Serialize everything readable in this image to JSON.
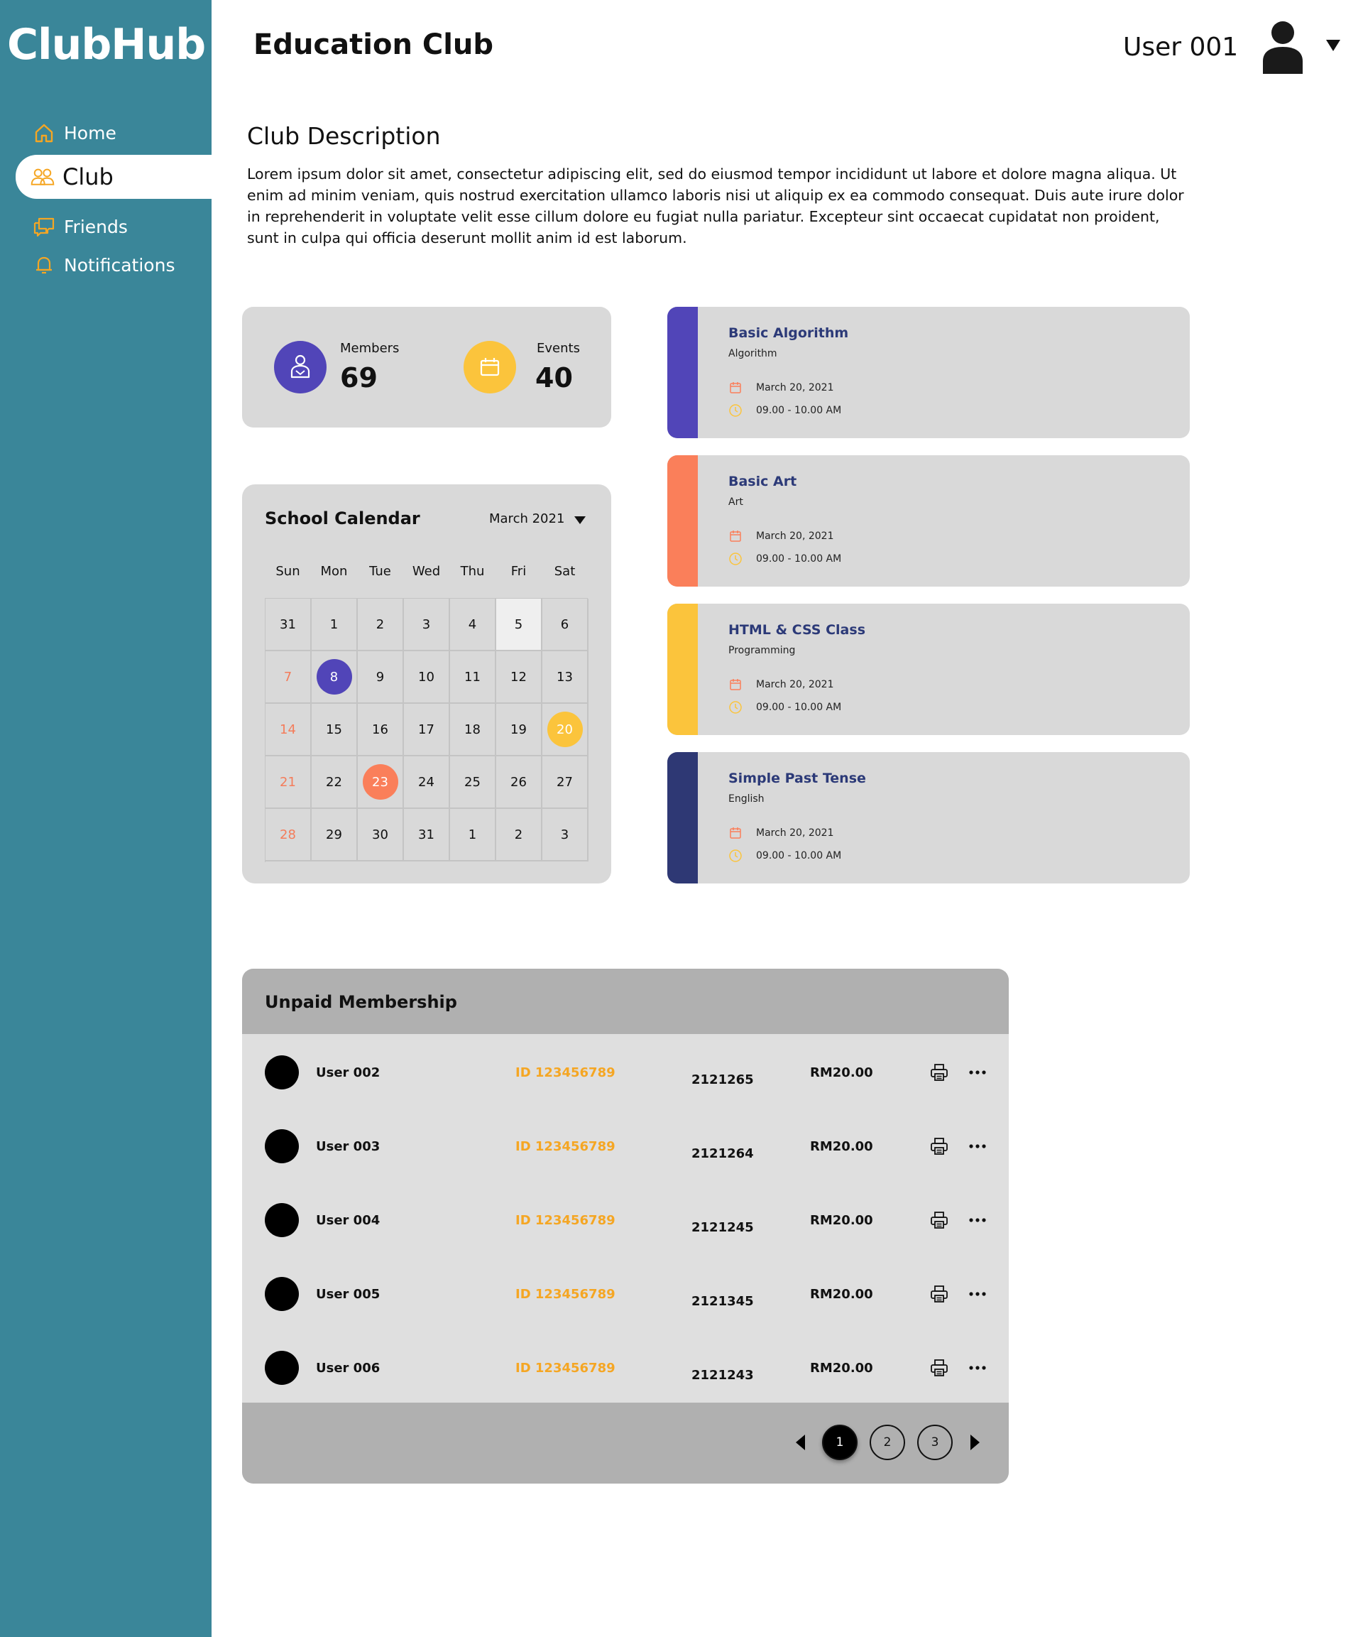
{
  "app": {
    "logo": "ClubHub"
  },
  "sidebar": {
    "items": [
      {
        "label": "Home",
        "icon": "home-icon"
      },
      {
        "label": "Club",
        "icon": "users-icon",
        "active": true
      },
      {
        "label": "Friends",
        "icon": "chat-icon"
      },
      {
        "label": "Notifications",
        "icon": "bell-icon"
      }
    ]
  },
  "header": {
    "title": "Education Club",
    "user": "User 001"
  },
  "description": {
    "title": "Club Description",
    "text": "Lorem ipsum dolor sit amet, consectetur adipiscing elit, sed do eiusmod tempor incididunt ut labore et dolore magna aliqua. Ut enim ad minim veniam, quis nostrud exercitation ullamco laboris nisi ut aliquip ex ea commodo consequat. Duis aute irure dolor in reprehenderit in voluptate velit esse cillum dolore eu fugiat nulla pariatur. Excepteur sint occaecat cupidatat non proident, sunt in culpa qui officia deserunt mollit anim id est laborum."
  },
  "stats": {
    "members_label": "Members",
    "members_value": "69",
    "events_label": "Events",
    "events_value": "40"
  },
  "calendar": {
    "title": "School Calendar",
    "month": "March 2021",
    "weekdays": [
      "Sun",
      "Mon",
      "Tue",
      "Wed",
      "Thu",
      "Fri",
      "Sat"
    ],
    "weeks": [
      [
        "31",
        "1",
        "2",
        "3",
        "4",
        "5",
        "6"
      ],
      [
        "7",
        "8",
        "9",
        "10",
        "11",
        "12",
        "13"
      ],
      [
        "14",
        "15",
        "16",
        "17",
        "18",
        "19",
        "20"
      ],
      [
        "21",
        "22",
        "23",
        "24",
        "25",
        "26",
        "27"
      ],
      [
        "28",
        "29",
        "30",
        "31",
        "1",
        "2",
        "3"
      ]
    ]
  },
  "events": [
    {
      "title": "Basic Algorithm",
      "subject": "Algorithm",
      "date": "March 20, 2021",
      "time": "09.00 - 10.00 AM",
      "color": "#5145b8"
    },
    {
      "title": "Basic Art",
      "subject": "Art",
      "date": "March 20, 2021",
      "time": "09.00 - 10.00 AM",
      "color": "#fa7f5a"
    },
    {
      "title": "HTML & CSS Class",
      "subject": "Programming",
      "date": "March 20, 2021",
      "time": "09.00 - 10.00 AM",
      "color": "#fbc43c"
    },
    {
      "title": "Simple Past Tense",
      "subject": "English",
      "date": "March 20, 2021",
      "time": "09.00 - 10.00 AM",
      "color": "#2e3874"
    }
  ],
  "unpaid": {
    "title": "Unpaid Membership",
    "rows": [
      {
        "name": "User 002",
        "id": "ID 123456789",
        "ref": "2121265",
        "amount": "RM20.00"
      },
      {
        "name": "User 003",
        "id": "ID 123456789",
        "ref": "2121264",
        "amount": "RM20.00"
      },
      {
        "name": "User 004",
        "id": "ID 123456789",
        "ref": "2121245",
        "amount": "RM20.00"
      },
      {
        "name": "User 005",
        "id": "ID 123456789",
        "ref": "2121345",
        "amount": "RM20.00"
      },
      {
        "name": "User 006",
        "id": "ID 123456789",
        "ref": "2121243",
        "amount": "RM20.00"
      }
    ],
    "pages": [
      "1",
      "2",
      "3"
    ],
    "current_page": "1"
  },
  "colors": {
    "sidebar": "#3a8699",
    "accent_orange": "#f5a623",
    "purple": "#5145b8",
    "yellow": "#fbc43c",
    "coral": "#fa7f5a",
    "navy": "#2e3874"
  }
}
